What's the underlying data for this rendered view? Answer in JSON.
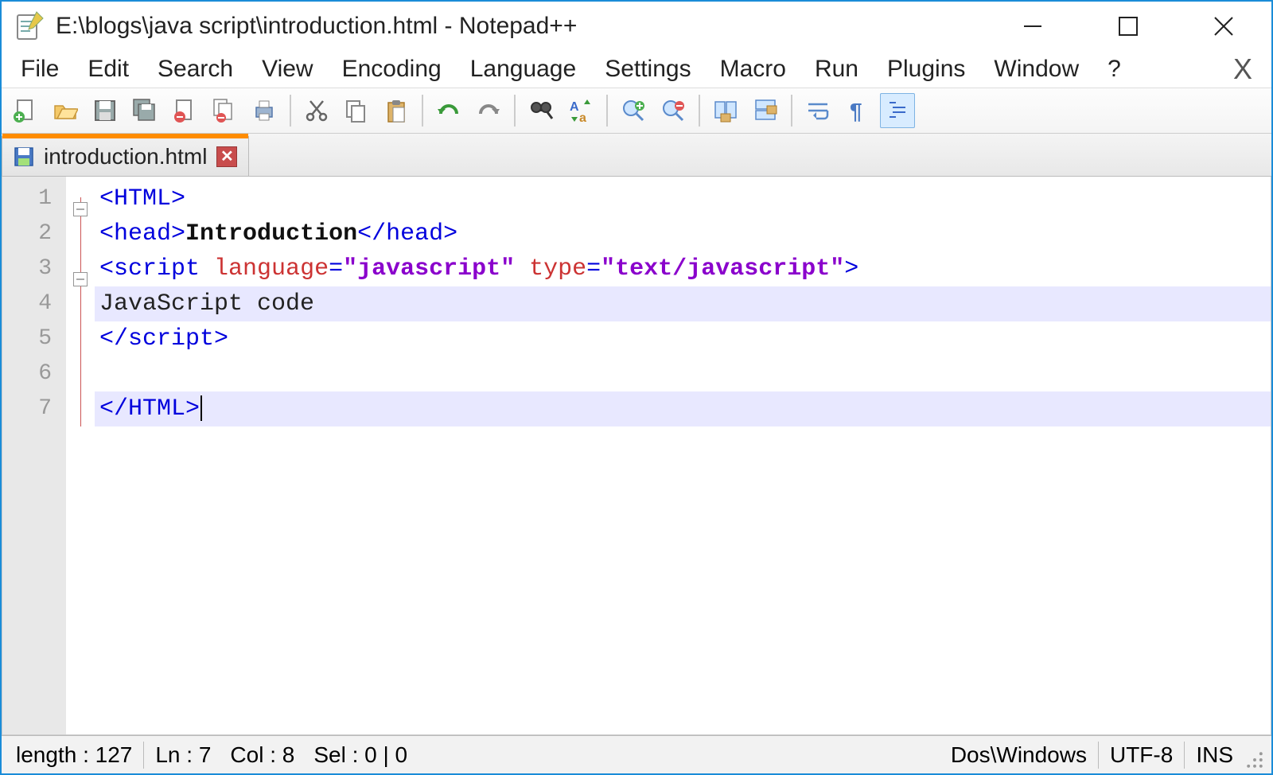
{
  "titlebar": {
    "title": "E:\\blogs\\java script\\introduction.html - Notepad++"
  },
  "menu": {
    "items": [
      "File",
      "Edit",
      "Search",
      "View",
      "Encoding",
      "Language",
      "Settings",
      "Macro",
      "Run",
      "Plugins",
      "Window",
      "?"
    ]
  },
  "toolbar": {
    "icons": [
      "new-file",
      "open-file",
      "save",
      "save-all",
      "close-file",
      "close-all",
      "print",
      "cut",
      "copy",
      "paste",
      "undo",
      "redo",
      "find",
      "find-replace",
      "zoom-in",
      "zoom-out",
      "sync-v",
      "sync-h",
      "word-wrap",
      "show-all",
      "doc-map"
    ]
  },
  "tab": {
    "label": "introduction.html"
  },
  "code": {
    "lines": [
      {
        "num": "1",
        "fold": "box",
        "parts": [
          {
            "c": "tagbr",
            "t": "<"
          },
          {
            "c": "tagname",
            "t": "HTML"
          },
          {
            "c": "tagbr",
            "t": ">"
          }
        ]
      },
      {
        "num": "2",
        "parts": [
          {
            "c": "tagbr",
            "t": "<"
          },
          {
            "c": "tagname",
            "t": "head"
          },
          {
            "c": "tagbr",
            "t": ">"
          },
          {
            "c": "bold",
            "t": "Introduction"
          },
          {
            "c": "tagbr",
            "t": "</"
          },
          {
            "c": "tagname",
            "t": "head"
          },
          {
            "c": "tagbr",
            "t": ">"
          }
        ]
      },
      {
        "num": "3",
        "fold": "box",
        "parts": [
          {
            "c": "tagbr",
            "t": "<"
          },
          {
            "c": "tagname",
            "t": "script "
          },
          {
            "c": "attrname",
            "t": "language"
          },
          {
            "c": "tagbr",
            "t": "="
          },
          {
            "c": "attrval",
            "t": "\"javascript\" "
          },
          {
            "c": "attrname",
            "t": "type"
          },
          {
            "c": "tagbr",
            "t": "="
          },
          {
            "c": "attrval",
            "t": "\"text/javascript\""
          },
          {
            "c": "tagbr",
            "t": ">"
          }
        ]
      },
      {
        "num": "4",
        "hl": true,
        "parts": [
          {
            "c": "txt",
            "t": "JavaScript code"
          }
        ]
      },
      {
        "num": "5",
        "parts": [
          {
            "c": "tagbr",
            "t": "</"
          },
          {
            "c": "tagname",
            "t": "script"
          },
          {
            "c": "tagbr",
            "t": ">"
          }
        ]
      },
      {
        "num": "6",
        "parts": []
      },
      {
        "num": "7",
        "hl": true,
        "cursor": true,
        "parts": [
          {
            "c": "tagbr",
            "t": "</"
          },
          {
            "c": "tagname",
            "t": "HTML"
          },
          {
            "c": "tagbr",
            "t": ">"
          }
        ]
      }
    ]
  },
  "status": {
    "length": "length : 127",
    "ln": "Ln : 7",
    "col": "Col : 8",
    "sel": "Sel : 0 | 0",
    "eol": "Dos\\Windows",
    "enc": "UTF-8",
    "ins": "INS"
  }
}
